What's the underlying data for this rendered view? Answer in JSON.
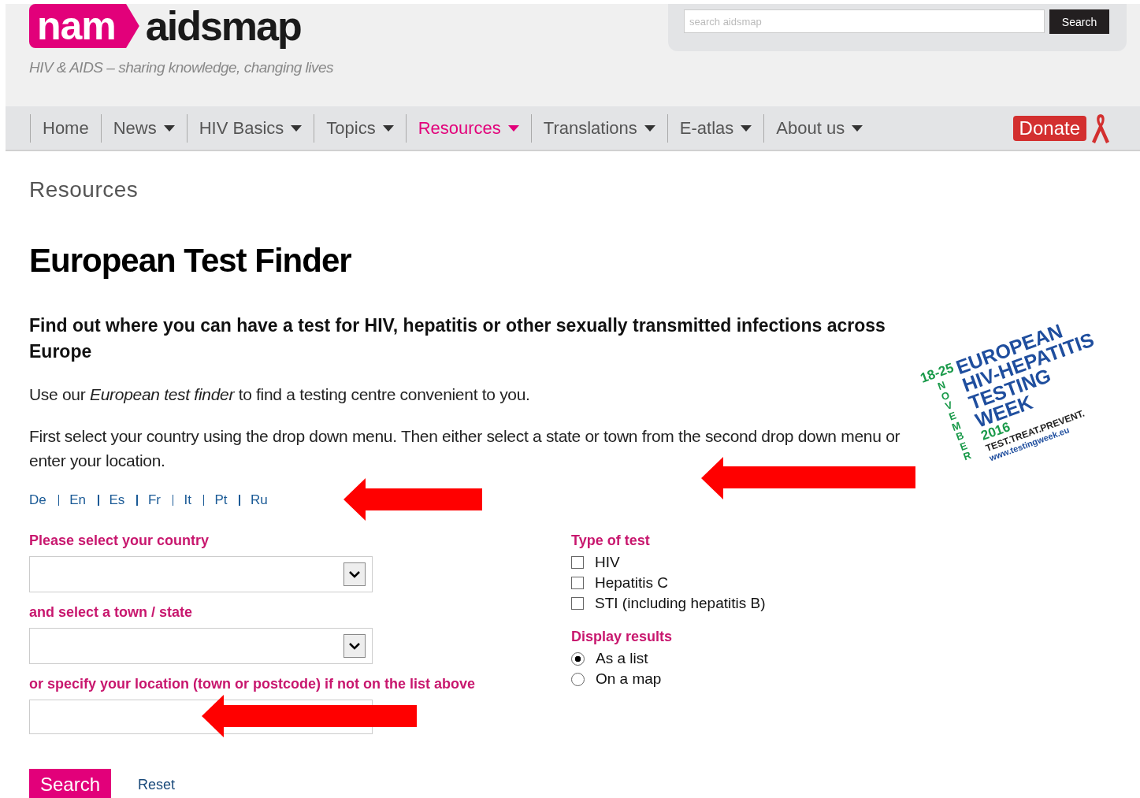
{
  "header": {
    "logo_badge": "nam",
    "logo_word": "aidsmap",
    "tagline": "HIV & AIDS – sharing knowledge, changing lives",
    "search": {
      "placeholder": "search aidsmap",
      "button": "Search"
    }
  },
  "nav": [
    {
      "label": "Home",
      "has_menu": false,
      "selected": false
    },
    {
      "label": "News",
      "has_menu": true,
      "selected": false
    },
    {
      "label": "HIV Basics",
      "has_menu": true,
      "selected": false
    },
    {
      "label": "Topics",
      "has_menu": true,
      "selected": false
    },
    {
      "label": "Resources",
      "has_menu": true,
      "selected": true
    },
    {
      "label": "Translations",
      "has_menu": true,
      "selected": false
    },
    {
      "label": "E-atlas",
      "has_menu": true,
      "selected": false
    },
    {
      "label": "About us",
      "has_menu": true,
      "selected": false
    }
  ],
  "donate": "Donate",
  "section": "Resources",
  "title": "European Test Finder",
  "intro": {
    "heading": "Find out where you can have a test for HIV, hepatitis or other sexually transmitted infections across Europe",
    "paragraphs": [
      "Use our *European test finder* to find a testing centre convenient to you.",
      "First select your country using the drop down menu. Then either select a state or town from the second drop down menu or enter your location."
    ]
  },
  "campaign_logo": {
    "dates": "18-25",
    "month": "NOVEMBER",
    "lines": [
      "EUROPEAN",
      "HIV-HEPATITIS",
      "TESTING",
      "WEEK"
    ],
    "year": "2016",
    "slogan": "TEST.TREAT.PREVENT.",
    "url": "www.testingweek.eu"
  },
  "languages": [
    "De",
    "En",
    "Es",
    "Fr",
    "It",
    "Pt",
    "Ru"
  ],
  "form": {
    "country_label": "Please select your country",
    "town_label": "and select a town / state",
    "location_label": "or specify your location (town or postcode) if not on the list above",
    "type_label": "Type of test",
    "tests": [
      {
        "label": "HIV",
        "checked": false
      },
      {
        "label": "Hepatitis C",
        "checked": false
      },
      {
        "label": "STI (including hepatitis B)",
        "checked": false
      }
    ],
    "display_label": "Display results",
    "display": [
      {
        "label": "As a list",
        "selected": true
      },
      {
        "label": "On a map",
        "selected": false
      }
    ],
    "search_button": "Search",
    "reset": "Reset"
  }
}
